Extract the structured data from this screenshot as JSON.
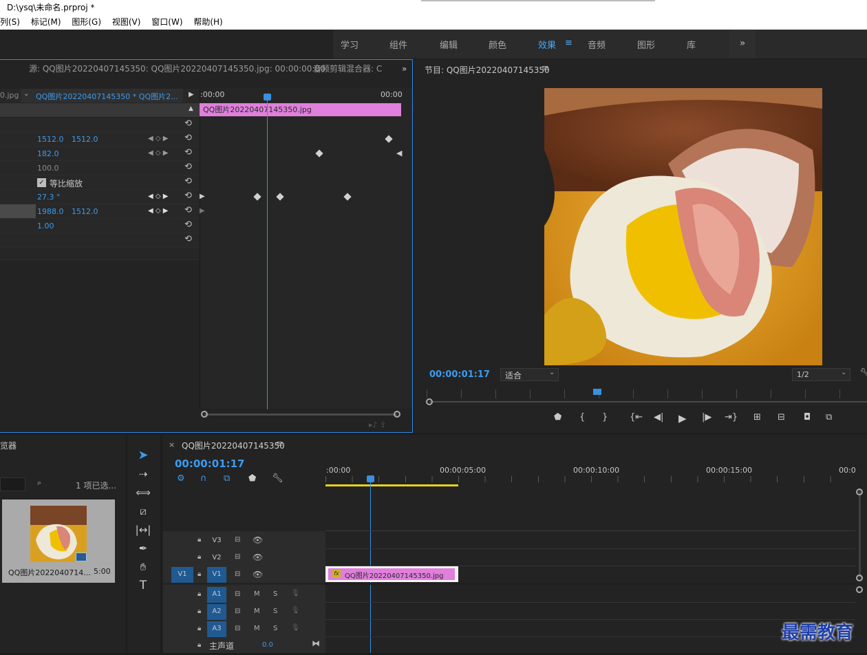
{
  "app": {
    "title": "D:\\ysq\\未命名.prproj *",
    "menu": [
      "列(S)",
      "标记(M)",
      "图形(G)",
      "视图(V)",
      "窗口(W)",
      "帮助(H)"
    ]
  },
  "workspaces": {
    "items": [
      "学习",
      "组件",
      "编辑",
      "颜色",
      "效果",
      "音频",
      "图形",
      "库"
    ],
    "active": "效果",
    "more": "»"
  },
  "effect_controls": {
    "source_tab": "源: QQ图片20220407145350: QQ图片20220407145350.jpg: 00:00:00:00",
    "audio_mixer_tab": "音频剪辑混合器: C",
    "left_name": "0.jpg",
    "clip_selector": "QQ图片20220407145350  * QQ图片2...",
    "time_start": ":00:00",
    "time_end": "00:00",
    "clip_bar_label": "QQ图片20220407145350.jpg",
    "position_x": "1512.0",
    "position_y": "1512.0",
    "scale": "182.0",
    "scale_width": "100.0",
    "uniform_scale_label": "等比缩放",
    "rotation": "27.3 °",
    "anchor_x": "1988.0",
    "anchor_y": "1512.0",
    "antiflicker": "1.00"
  },
  "program_monitor": {
    "title": "节目: QQ图片20220407145350",
    "timecode": "00:00:01:17",
    "fit": "适合",
    "resolution": "1/2"
  },
  "project": {
    "title": "览器",
    "selected_count": "1 项已选...",
    "clip_name": "QQ图片2022040714...",
    "clip_duration": "5:00"
  },
  "timeline": {
    "sequence_tab": "QQ图片20220407145350",
    "timecode": "00:00:01:17",
    "ruler": [
      ":00:00",
      "00:00:05:00",
      "00:00:10:00",
      "00:00:15:00",
      "00:0"
    ],
    "video_tracks": [
      "V3",
      "V2",
      "V1"
    ],
    "audio_tracks": [
      "A1",
      "A2",
      "A3"
    ],
    "source_patch": "V1",
    "master_label": "主声道",
    "master_value": "0.0",
    "clip_label": "QQ图片20220407145350.jpg",
    "clip_fx": "fx",
    "mute": "M",
    "solo": "S"
  },
  "watermark": "最需教育",
  "colors": {
    "accent": "#2d8ceb",
    "clip_pink": "#e07fdc",
    "work_area": "#e7d31c"
  }
}
